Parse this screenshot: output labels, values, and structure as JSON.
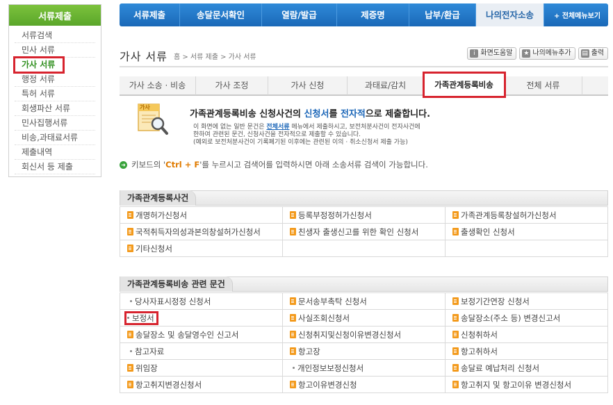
{
  "sidebar": {
    "title": "서류제출",
    "items": [
      {
        "label": "서류검색"
      },
      {
        "label": "민사 서류"
      },
      {
        "label": "가사 서류"
      },
      {
        "label": "행정 서류"
      },
      {
        "label": "특허 서류"
      },
      {
        "label": "회생파산 서류"
      },
      {
        "label": "민사집행서류"
      },
      {
        "label": "비송,과태료서류"
      },
      {
        "label": "제출내역"
      },
      {
        "label": "회신서 등 제출"
      }
    ]
  },
  "topnav": {
    "items": [
      {
        "label": "서류제출"
      },
      {
        "label": "송달문서확인"
      },
      {
        "label": "열람/발급"
      },
      {
        "label": "제증명"
      },
      {
        "label": "납부/환급"
      },
      {
        "label": "나의전자소송"
      }
    ],
    "all_menu": "+ 전체메뉴보기"
  },
  "header": {
    "title": "가사 서류",
    "breadcrumb": "홈 > 서류 제출 > 가사 서류",
    "tools": [
      {
        "label": "화면도움말",
        "icon": "help-icon"
      },
      {
        "label": "나의메뉴추가",
        "icon": "bookmark-icon"
      },
      {
        "label": "출력",
        "icon": "print-icon"
      }
    ]
  },
  "tabs": [
    {
      "label": "가사 소송 · 비송"
    },
    {
      "label": "가사 조정"
    },
    {
      "label": "가사 신청"
    },
    {
      "label": "과태료/감치"
    },
    {
      "label": "가족관계등록비송"
    },
    {
      "label": "전체 서류"
    }
  ],
  "intro": {
    "icon_label": "가사",
    "title_part1": "가족관계등록비송 신청사건의 ",
    "title_blue1": "신청서",
    "title_part2": "를 ",
    "title_blue2": "전자적",
    "title_part3": "으로 제출합니다.",
    "desc1_pre": "이 화면에 없는 일반 문건은 ",
    "desc1_link": "전체서류",
    "desc1_post": " 메뉴에서 제출하시고, 보전처분사건이 전자사건에",
    "desc2": "한하여 관련된 문건, 신청사건을 전자적으로 제출할 수 있습니다.",
    "desc3": "(예외로 보전처분사건이 기록폐기된 이후에는 관련된 이의 · 취소신청서 제출 가능)",
    "hint_pre": "키보드의 '",
    "hint_key": "Ctrl + F",
    "hint_post": "'를 누르시고 검색어를 입력하시면 아래 소송서류 검색이 가능합니다."
  },
  "section1": {
    "title": "가족관계등록사건",
    "rows": [
      [
        "개명허가신청서",
        "등록부정정허가신청서",
        "가족관계등록창설허가신청서"
      ],
      [
        "국적취득자의성과본의창설허가신청서",
        "친생자 출생신고를 위한 확인 신청서",
        "출생확인 신청서"
      ],
      [
        "기타신청서",
        "",
        ""
      ]
    ]
  },
  "section2": {
    "title": "가족관계등록비송 관련 문건",
    "rows": [
      [
        "당사자표시정정 신청서",
        "문서송부촉탁 신청서",
        "보정기간연장 신청서"
      ],
      [
        "보정서",
        "사실조회신청서",
        "송달장소(주소 등) 변경신고서"
      ],
      [
        "송달장소 및 송달영수인 신고서",
        "신청취지및신청이유변경신청서",
        "신청취하서"
      ],
      [
        "참고자료",
        "항고장",
        "항고취하서"
      ],
      [
        "위임장",
        "개인정보보정신청서",
        "송달료 예납처리 신청서"
      ],
      [
        "항고취지변경신청서",
        "항고이유변경신청",
        "항고취지 및 항고이유 변경신청서"
      ]
    ]
  }
}
